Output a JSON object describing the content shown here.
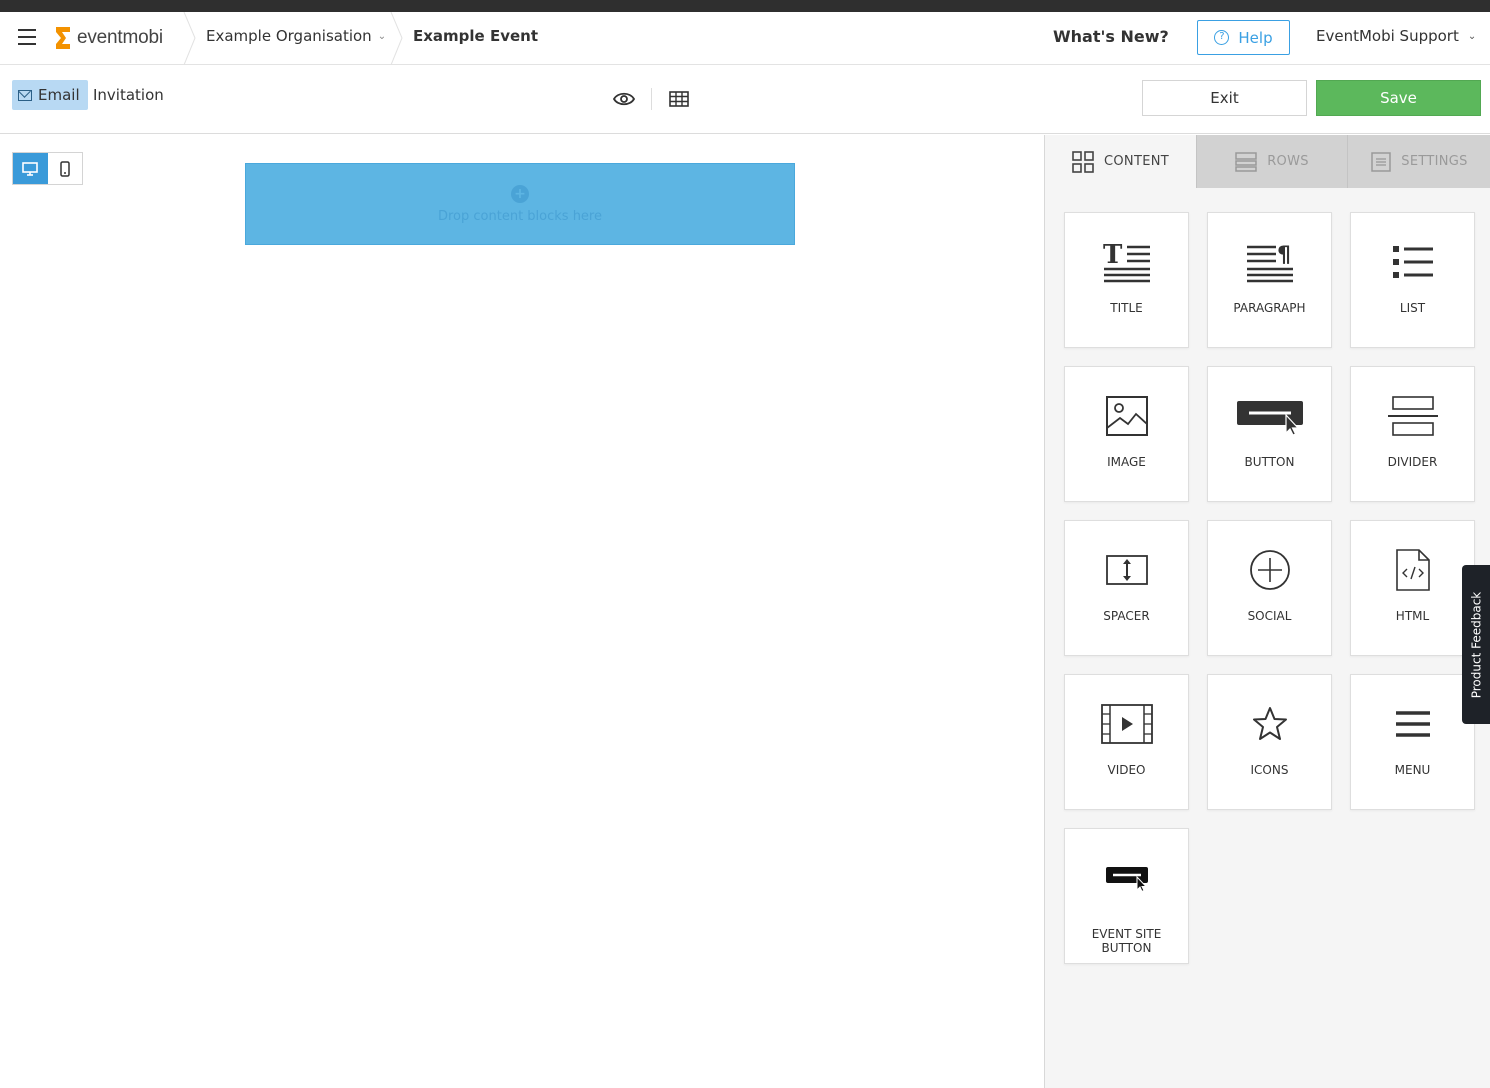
{
  "header": {
    "logo_text": "eventmobi",
    "organisation": "Example Organisation",
    "event": "Example Event",
    "whats_new": "What's New?",
    "help_label": "Help",
    "user_menu": "EventMobi Support"
  },
  "toolbar": {
    "email_label": "Email",
    "doc_name": "Invitation",
    "exit_label": "Exit",
    "save_label": "Save"
  },
  "canvas": {
    "dropzone_text": "Drop content blocks here"
  },
  "panel": {
    "tabs": [
      {
        "label": "CONTENT",
        "icon": "grid-icon",
        "active": true
      },
      {
        "label": "ROWS",
        "icon": "rows-icon",
        "active": false
      },
      {
        "label": "SETTINGS",
        "icon": "settings-icon",
        "active": false
      }
    ],
    "blocks": [
      {
        "label": "TITLE",
        "icon": "title-icon"
      },
      {
        "label": "PARAGRAPH",
        "icon": "paragraph-icon"
      },
      {
        "label": "LIST",
        "icon": "list-icon"
      },
      {
        "label": "IMAGE",
        "icon": "image-icon"
      },
      {
        "label": "BUTTON",
        "icon": "button-icon"
      },
      {
        "label": "DIVIDER",
        "icon": "divider-icon"
      },
      {
        "label": "SPACER",
        "icon": "spacer-icon"
      },
      {
        "label": "SOCIAL",
        "icon": "social-icon"
      },
      {
        "label": "HTML",
        "icon": "html-icon"
      },
      {
        "label": "VIDEO",
        "icon": "video-icon"
      },
      {
        "label": "ICONS",
        "icon": "star-icon"
      },
      {
        "label": "MENU",
        "icon": "menu-icon"
      },
      {
        "label": "EVENT SITE BUTTON",
        "icon": "event-site-button-icon"
      }
    ]
  },
  "feedback_label": "Product Feedback",
  "colors": {
    "accent": "#3aa0e3",
    "save_green": "#5cb85c",
    "dropzone": "#5db5e3",
    "logo_orange": "#f39200"
  }
}
